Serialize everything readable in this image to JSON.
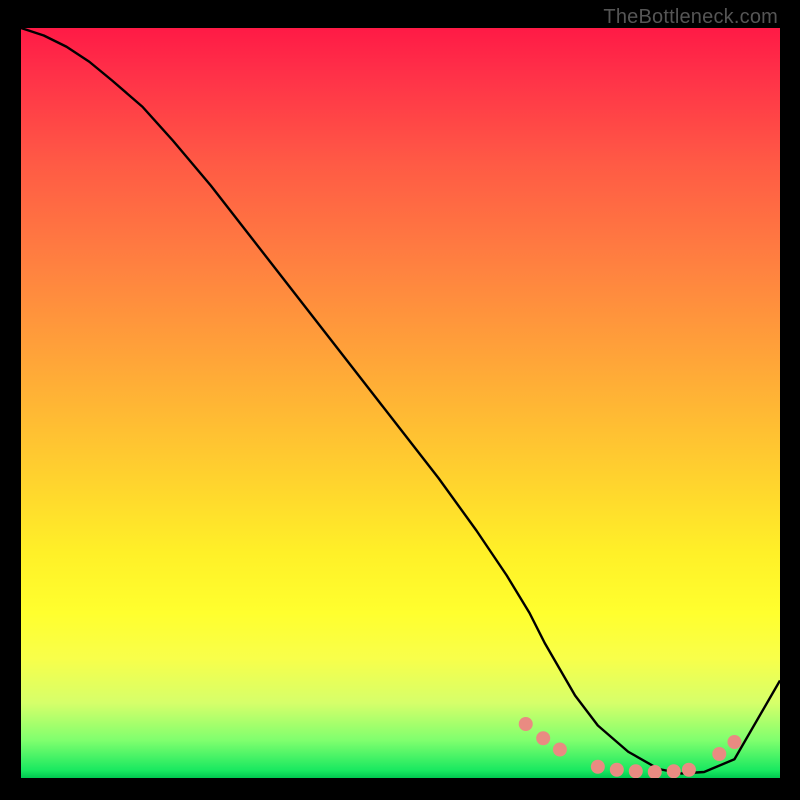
{
  "watermark": "TheBottleneck.com",
  "chart_data": {
    "type": "line",
    "title": "",
    "xlabel": "",
    "ylabel": "",
    "xlim": [
      0,
      100
    ],
    "ylim": [
      0,
      100
    ],
    "grid": false,
    "series": [
      {
        "name": "bottleneck-curve",
        "x": [
          0,
          3,
          6,
          9,
          12,
          16,
          20,
          25,
          30,
          35,
          40,
          45,
          50,
          55,
          60,
          64,
          67,
          69,
          71,
          73,
          76,
          80,
          84,
          87,
          90,
          94,
          100
        ],
        "y": [
          100,
          99,
          97.5,
          95.5,
          93,
          89.5,
          85,
          79,
          72.5,
          66,
          59.5,
          53,
          46.5,
          40,
          33,
          27,
          22,
          18,
          14.5,
          11,
          7,
          3.5,
          1.2,
          0.6,
          0.8,
          2.5,
          13
        ],
        "color": "#000000"
      }
    ],
    "markers": {
      "name": "dots",
      "color": "#e98b82",
      "points": [
        {
          "x": 66.5,
          "y": 7.2
        },
        {
          "x": 68.8,
          "y": 5.3
        },
        {
          "x": 71.0,
          "y": 3.8
        },
        {
          "x": 76.0,
          "y": 1.5
        },
        {
          "x": 78.5,
          "y": 1.1
        },
        {
          "x": 81.0,
          "y": 0.9
        },
        {
          "x": 83.5,
          "y": 0.8
        },
        {
          "x": 86.0,
          "y": 0.9
        },
        {
          "x": 88.0,
          "y": 1.1
        },
        {
          "x": 92.0,
          "y": 3.2
        },
        {
          "x": 94.0,
          "y": 4.8
        }
      ]
    },
    "gradient_stops": [
      {
        "pos": 0.0,
        "color": "#ff1a46"
      },
      {
        "pos": 0.3,
        "color": "#ff7a40"
      },
      {
        "pos": 0.6,
        "color": "#ffd22e"
      },
      {
        "pos": 0.8,
        "color": "#ffff30"
      },
      {
        "pos": 0.95,
        "color": "#7fff6e"
      },
      {
        "pos": 1.0,
        "color": "#00c850"
      }
    ]
  }
}
